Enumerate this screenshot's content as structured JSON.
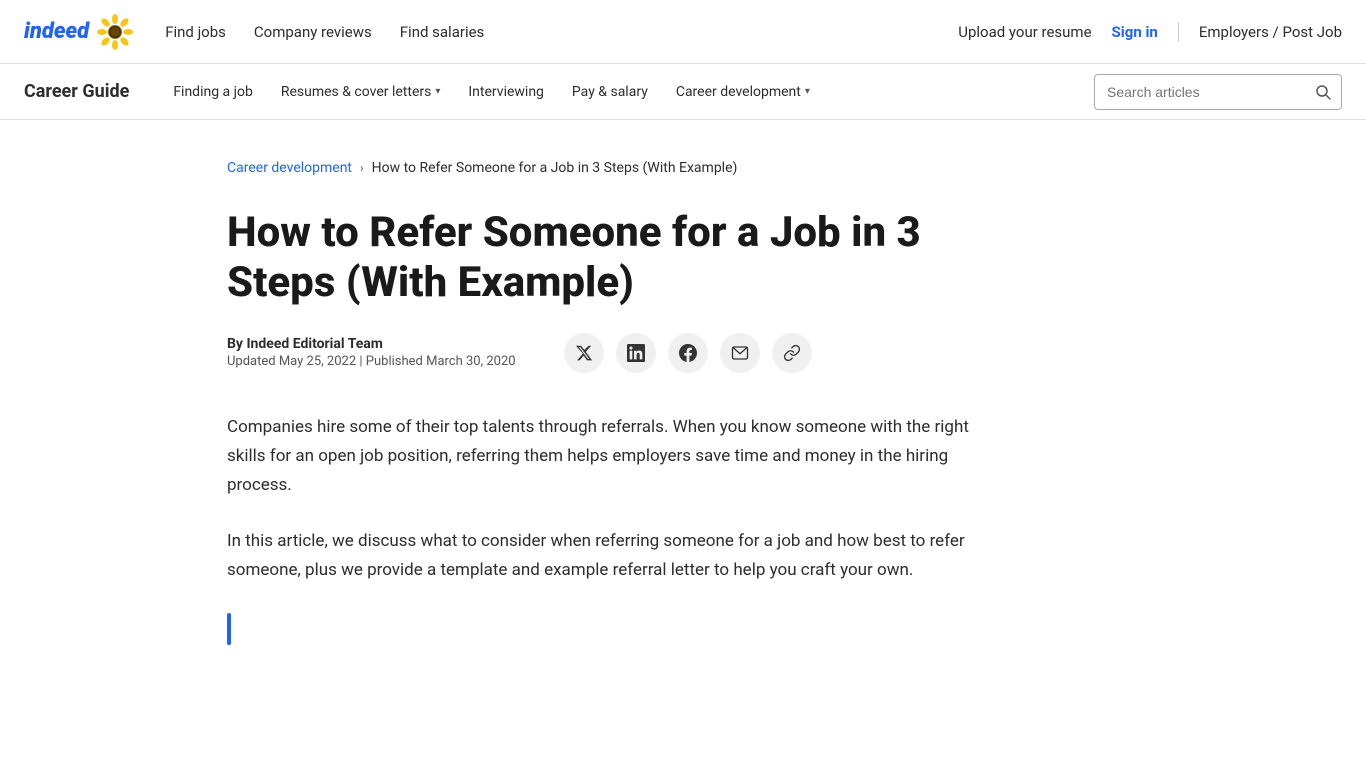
{
  "topNav": {
    "logoText": "indeed",
    "navLinks": [
      {
        "id": "find-jobs",
        "label": "Find jobs"
      },
      {
        "id": "company-reviews",
        "label": "Company reviews"
      },
      {
        "id": "find-salaries",
        "label": "Find salaries"
      }
    ],
    "rightLinks": {
      "uploadResume": "Upload your resume",
      "signIn": "Sign in",
      "employersPostJob": "Employers / Post Job"
    }
  },
  "careerNav": {
    "title": "Career Guide",
    "links": [
      {
        "id": "finding-a-job",
        "label": "Finding a job",
        "hasDropdown": false
      },
      {
        "id": "resumes-cover-letters",
        "label": "Resumes & cover letters",
        "hasDropdown": true
      },
      {
        "id": "interviewing",
        "label": "Interviewing",
        "hasDropdown": false
      },
      {
        "id": "pay-salary",
        "label": "Pay & salary",
        "hasDropdown": false
      },
      {
        "id": "career-development",
        "label": "Career development",
        "hasDropdown": true
      }
    ],
    "search": {
      "placeholder": "Search articles"
    }
  },
  "breadcrumb": {
    "parent": "Career development",
    "separator": "›",
    "current": "How to Refer Someone for a Job in 3 Steps (With Example)"
  },
  "article": {
    "title": "How to Refer Someone for a Job in 3 Steps (With Example)",
    "author": "By Indeed Editorial Team",
    "dates": "Updated May 25, 2022 | Published March 30, 2020",
    "shareIcons": [
      {
        "id": "twitter",
        "symbol": "𝕏"
      },
      {
        "id": "linkedin",
        "symbol": "in"
      },
      {
        "id": "facebook",
        "symbol": "f"
      },
      {
        "id": "email",
        "symbol": "✉"
      },
      {
        "id": "link",
        "symbol": "🔗"
      }
    ],
    "paragraphs": [
      "Companies hire some of their top talents through referrals. When you know someone with the right skills for an open job position, referring them helps employers save time and money in the hiring process.",
      "In this article, we discuss what to consider when referring someone for a job and how best to refer someone, plus we provide a template and example referral letter to help you craft your own."
    ]
  }
}
